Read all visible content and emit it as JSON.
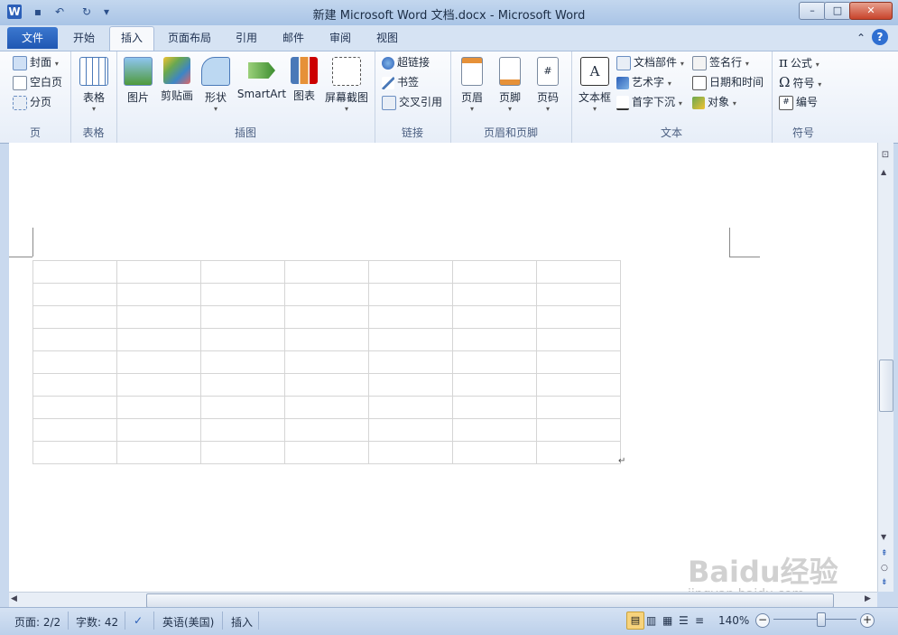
{
  "window": {
    "title": "新建 Microsoft Word 文档.docx - Microsoft Word",
    "min_label": "–",
    "max_label": "□",
    "close_label": "✕"
  },
  "qat": {
    "app_icon": "W",
    "save_icon": "▪",
    "undo_icon": "↶",
    "redo_icon": "↻",
    "customize_icon": "▾"
  },
  "tabs": [
    {
      "label": "文件"
    },
    {
      "label": "开始"
    },
    {
      "label": "插入"
    },
    {
      "label": "页面布局"
    },
    {
      "label": "引用"
    },
    {
      "label": "邮件"
    },
    {
      "label": "审阅"
    },
    {
      "label": "视图"
    }
  ],
  "tab_right": {
    "minimize_ribbon": "⌃",
    "help": "?"
  },
  "ribbon": {
    "pages": {
      "label": "页",
      "items": [
        "封面",
        "空白页",
        "分页"
      ]
    },
    "tables": {
      "label": "表格",
      "button": "表格"
    },
    "illustrations": {
      "label": "插图",
      "buttons": [
        "图片",
        "剪贴画",
        "形状",
        "SmartArt",
        "图表",
        "屏幕截图"
      ]
    },
    "links": {
      "label": "链接",
      "items": [
        "超链接",
        "书签",
        "交叉引用"
      ]
    },
    "header_footer": {
      "label": "页眉和页脚",
      "buttons": [
        "页眉",
        "页脚",
        "页码"
      ]
    },
    "text": {
      "label": "文本",
      "textbox": "文本框",
      "items_left": [
        "文档部件",
        "艺术字",
        "首字下沉"
      ],
      "items_right": [
        "签名行",
        "日期和时间",
        "对象"
      ]
    },
    "symbols": {
      "label": "符号",
      "items": [
        "公式",
        "符号",
        "编号"
      ]
    }
  },
  "document": {
    "table_rows": 9,
    "table_cols": 7,
    "para_mark": "↵"
  },
  "statusbar": {
    "page": "页面: 2/2",
    "words": "字数: 42",
    "language": "英语(美国)",
    "mode": "插入",
    "zoom": "140%",
    "zoom_level": 0.56
  },
  "watermark": {
    "text": "Baidu经验",
    "url": "jingyan.baidu.com"
  },
  "colors": {
    "file_tab": "#2a62c0",
    "ribbon_bg": "#eef3fa",
    "accent_blue": "#1f57b3"
  }
}
